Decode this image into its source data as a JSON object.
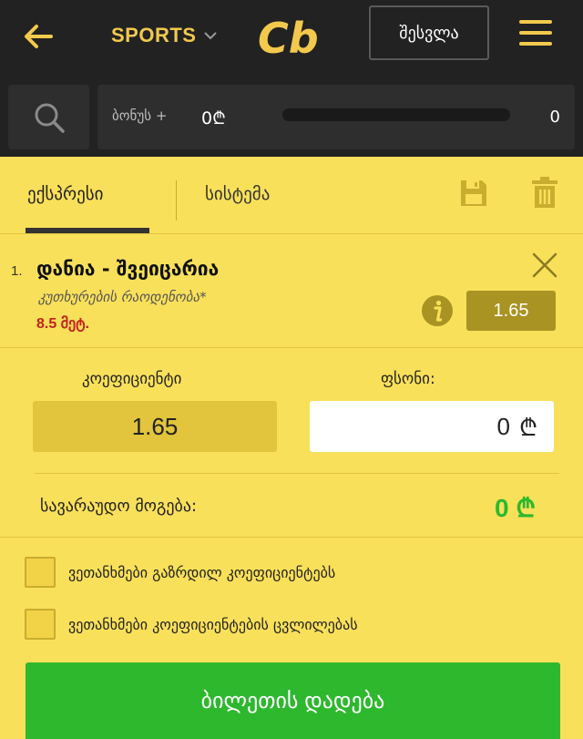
{
  "header": {
    "sports_label": "SPORTS",
    "logo_text": "Cb",
    "logout_label": "შესვლა"
  },
  "bonus": {
    "label": "ბონუს +",
    "amount": "0₾",
    "progress": 0,
    "right_value": "0"
  },
  "tabs": {
    "express": "ექსპრესი",
    "system": "სისტემა"
  },
  "bet": {
    "number": "1.",
    "title": "დანია - შვეიცარია",
    "market": "კუთხურების რაოდენობა*",
    "line": "8.5 მეტ.",
    "odds": "1.65"
  },
  "stake": {
    "coef_label": "კოეფიციენტი",
    "coef_value": "1.65",
    "stake_label": "ფსონი:",
    "stake_value": "0",
    "currency": "₾"
  },
  "winnings": {
    "label": "სავარაუდო მოგება:",
    "value": "0 ₾"
  },
  "options": {
    "increased_odds": "ვეთანხმები გაზრდილ კოეფიციენტებს",
    "odds_change": "ვეთანხმები კოეფიციენტების ცვლილებას"
  },
  "submit_label": "ბილეთის დადება",
  "colors": {
    "header_bg": "#222222",
    "accent": "#f2c94c",
    "panel_bg": "#f9e05a",
    "odds_badge": "#a89323",
    "success": "#2eb82e",
    "line_red": "#c42020"
  }
}
